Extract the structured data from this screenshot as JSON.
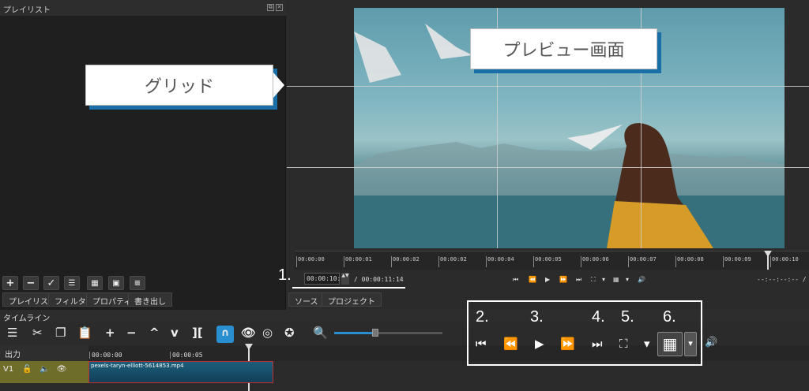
{
  "playlist": {
    "title": "プレイリスト",
    "float_label": "⧉",
    "close_label": "✕",
    "tabs": [
      "プレイリスト",
      "フィルタ",
      "プロパティ",
      "書き出し"
    ],
    "toolbar_icons": [
      "add-icon",
      "remove-icon",
      "check-icon",
      "details-icon",
      "tiles-icon",
      "icons-view-icon",
      "menu-icon"
    ]
  },
  "preview": {
    "callout_grid": "グリッド",
    "callout_preview": "プレビュー画面",
    "ruler_ticks": [
      "00:00:00",
      "00:00:01",
      "00:00:02",
      "00:00:02",
      "00:00:04",
      "00:00:05",
      "00:00:06",
      "00:00:07",
      "00:00:08",
      "00:00:09",
      "00:00:10"
    ],
    "current_time": "00:00:10:00",
    "total_time": "/ 00:00:11:14",
    "right_time": "--:--:--:-- /",
    "tabs": [
      "ソース",
      "プロジェクト"
    ],
    "numbers": [
      "1.",
      "2.",
      "3.",
      "4.",
      "5.",
      "6."
    ]
  },
  "timeline": {
    "title": "タイムライン",
    "output_label": "出力",
    "track_label": "V1",
    "ruler": [
      "00:00:00",
      "00:00:05"
    ],
    "clip_name": "pexels-taryn-elliott-5614853.mp4"
  },
  "colors": {
    "accent": "#1a6fa8",
    "clip_border": "#c03030",
    "track": "#6f6d2a"
  }
}
